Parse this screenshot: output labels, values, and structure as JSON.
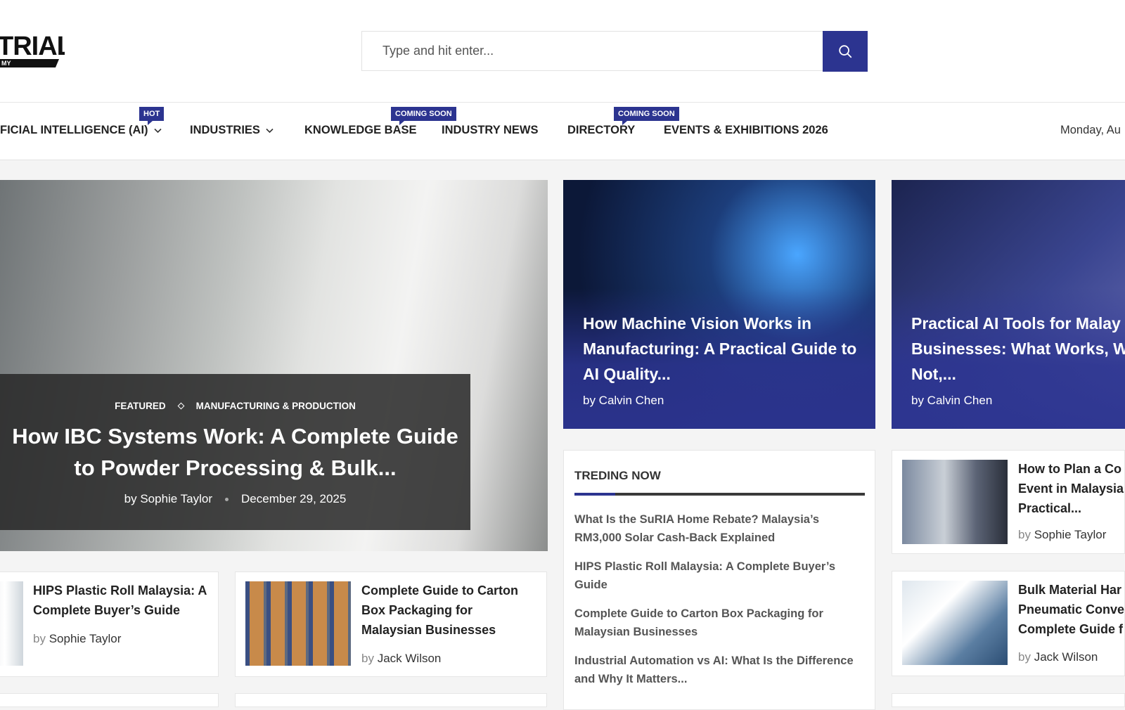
{
  "header": {
    "logo_text": "TRIAL",
    "logo_sub": "MY",
    "search_placeholder": "Type and hit enter..."
  },
  "nav": {
    "items": [
      {
        "label": "FICIAL INTELLIGENCE (AI)",
        "badge": "HOT"
      },
      {
        "label": "INDUSTRIES",
        "badge": ""
      },
      {
        "label": "KNOWLEDGE BASE",
        "badge": "COMING SOON"
      },
      {
        "label": "INDUSTRY NEWS",
        "badge": ""
      },
      {
        "label": "DIRECTORY",
        "badge": "COMING SOON"
      },
      {
        "label": "EVENTS & EXHIBITIONS 2026",
        "badge": ""
      }
    ],
    "date": "Monday, Au"
  },
  "hero": {
    "category1": "FEATURED",
    "category2": "MANUFACTURING & PRODUCTION",
    "title": "How IBC Systems Work: A Complete Guide to Powder Processing & Bulk...",
    "author": "Sophie Taylor",
    "date": "December 29, 2025",
    "by": "by"
  },
  "top_cards": [
    {
      "title": "How Machine Vision Works in Manufacturing: A Practical Guide to AI Quality...",
      "author": "by Calvin Chen"
    },
    {
      "title": "Practical AI Tools for Malay Businesses: What Works, W Does Not,...",
      "author": "by Calvin Chen"
    }
  ],
  "trending": {
    "heading": "TREDING NOW",
    "items": [
      "What Is the SuRIA Home Rebate? Malaysia’s RM3,000 Solar Cash-Back Explained",
      "HIPS Plastic Roll Malaysia: A Complete Buyer’s Guide",
      "Complete Guide to Carton Box Packaging for Malaysian Businesses",
      "Industrial Automation vs AI: What Is the Difference and Why It Matters..."
    ]
  },
  "small_cards": [
    {
      "title": "HIPS Plastic Roll Malaysia: A Complete Buyer’s Guide",
      "by": "by",
      "author": "Sophie Taylor"
    },
    {
      "title": "Complete Guide to Carton Box Packaging for Malaysian Businesses",
      "by": "by",
      "author": "Jack Wilson"
    },
    {
      "title": "How to Plan a Co Event in Malaysia Practical...",
      "by": "by",
      "author": "Sophie Taylor"
    },
    {
      "title": "Bulk Material Har Pneumatic Conve Complete Guide f",
      "by": "by",
      "author": "Jack Wilson"
    }
  ],
  "colors": {
    "accent": "#2c3490"
  }
}
